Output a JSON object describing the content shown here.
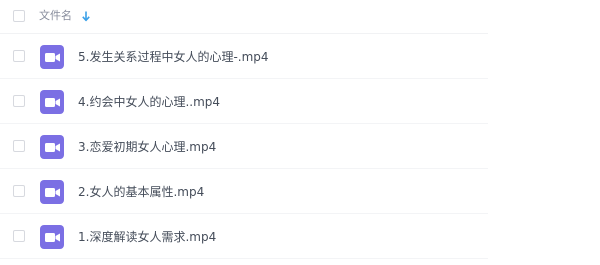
{
  "header": {
    "column_label": "文件名",
    "sort_direction": "descending"
  },
  "files": [
    {
      "name": "5.发生关系过程中女人的心理-.mp4",
      "type": "video"
    },
    {
      "name": "4.约会中女人的心理..mp4",
      "type": "video"
    },
    {
      "name": "3.恋爱初期女人心理.mp4",
      "type": "video"
    },
    {
      "name": "2.女人的基本属性.mp4",
      "type": "video"
    },
    {
      "name": "1.深度解读女人需求.mp4",
      "type": "video"
    }
  ],
  "colors": {
    "video_icon": "#7b6fe4",
    "sort_arrow": "#3aa0e8",
    "text": "#454d5a",
    "header_text": "#878c9c"
  },
  "icons": {
    "file": "video-file-icon",
    "sort": "arrow-down-icon"
  }
}
